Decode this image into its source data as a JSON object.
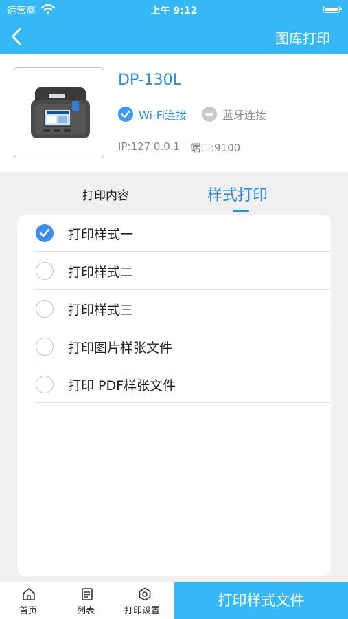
{
  "status_bar": {
    "carrier": "运营商",
    "time": "上午 9:12"
  },
  "nav": {
    "title": "图库打印"
  },
  "device": {
    "name": "DP-130L",
    "wifi_label": "Wi-Fi连接",
    "bluetooth_label": "蓝牙连接",
    "ip": "IP:127.0.0.1",
    "port": "端口:9100"
  },
  "tabs": [
    {
      "label": "打印内容",
      "active": false
    },
    {
      "label": "样式打印",
      "active": true
    }
  ],
  "options": [
    {
      "label": "打印样式一",
      "checked": true
    },
    {
      "label": "打印样式二",
      "checked": false
    },
    {
      "label": "打印样式三",
      "checked": false
    },
    {
      "label": "打印图片样张文件",
      "checked": false
    },
    {
      "label": "打印 PDF样张文件",
      "checked": false
    }
  ],
  "tab_bar": {
    "home": "首页",
    "list": "列表",
    "settings": "打印设置",
    "print_button": "打印样式文件"
  },
  "colors": {
    "accent": "#35b8f5",
    "link_blue": "#2a8de0",
    "background": "#f0f0f0"
  },
  "icons": {
    "status": [
      "wifi-signal-icon",
      "battery-icon"
    ],
    "nav": "back-chevron-icon",
    "tab_bar": [
      "home-icon",
      "list-icon",
      "settings-gear-icon"
    ]
  }
}
